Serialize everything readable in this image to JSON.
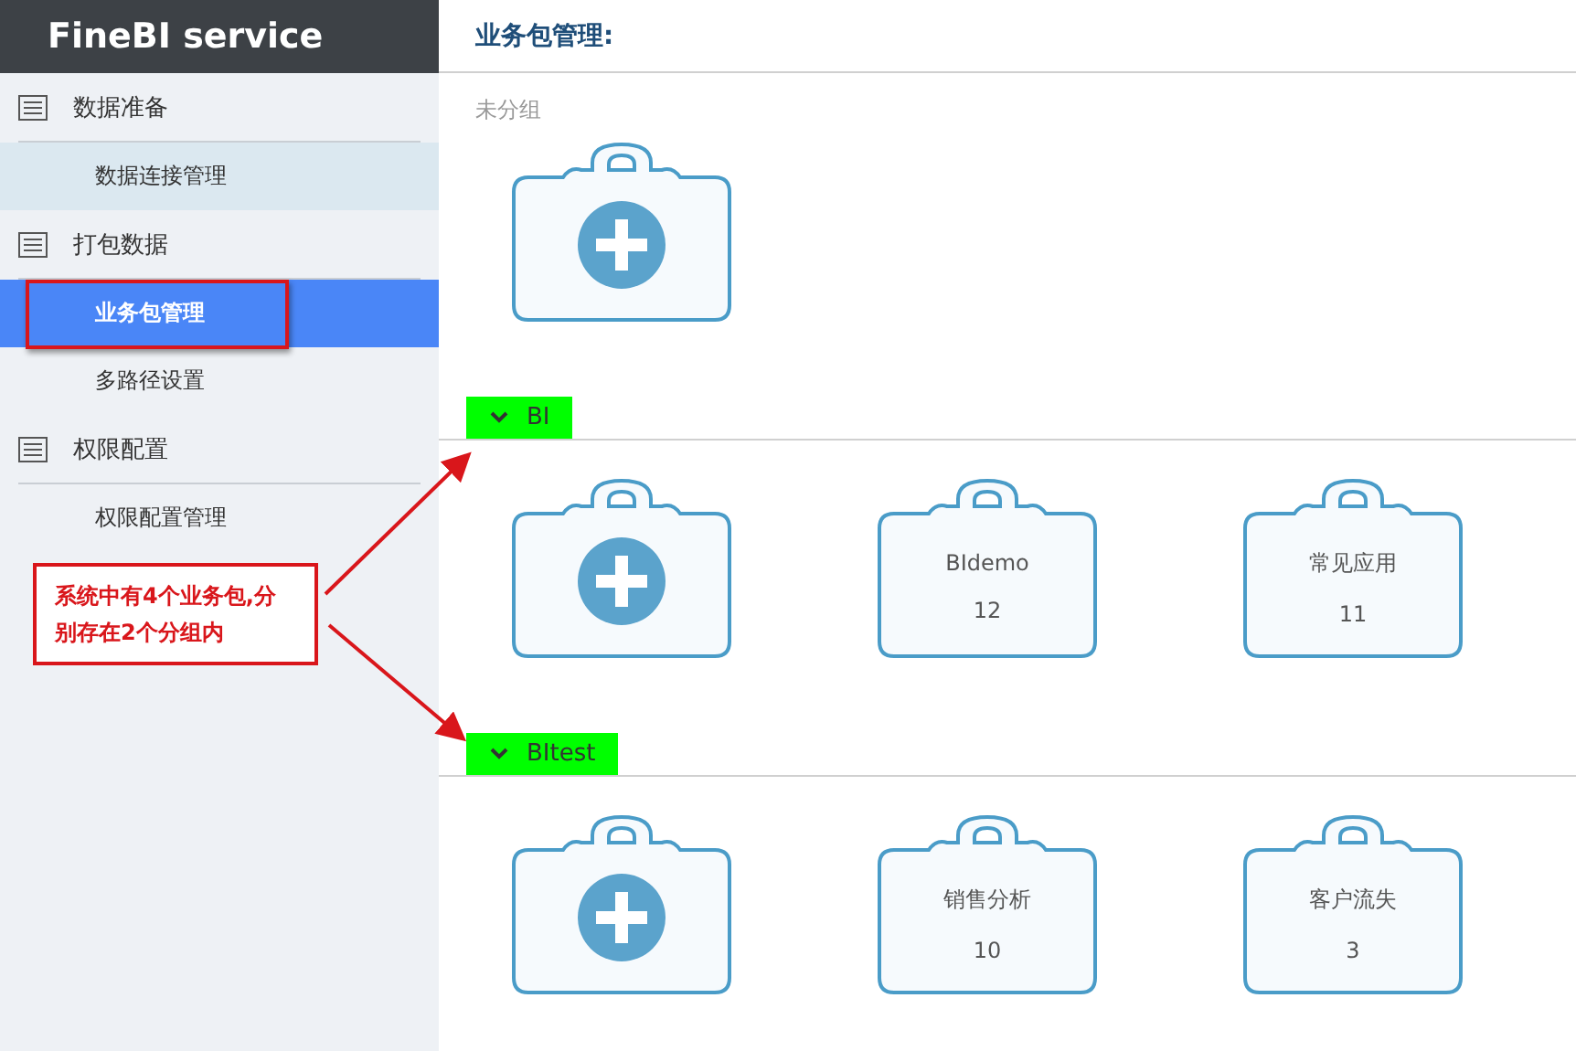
{
  "brand": "FineBI service",
  "sidebar": {
    "sections": [
      {
        "label": "数据准备",
        "items": [
          {
            "label": "数据连接管理",
            "selected": false,
            "hovered": true
          }
        ]
      },
      {
        "label": "打包数据",
        "items": [
          {
            "label": "业务包管理",
            "selected": true,
            "hovered": false
          },
          {
            "label": "多路径设置",
            "selected": false,
            "hovered": false
          }
        ]
      },
      {
        "label": "权限配置",
        "items": [
          {
            "label": "权限配置管理",
            "selected": false,
            "hovered": false
          }
        ]
      }
    ]
  },
  "page_title": "业务包管理:",
  "groups": [
    {
      "kind": "plain",
      "label": "未分组"
    },
    {
      "kind": "collapsible",
      "label": "BI",
      "expanded": true,
      "packages": [
        {
          "name": "BIdemo",
          "count": "12"
        },
        {
          "name": "常见应用",
          "count": "11"
        }
      ]
    },
    {
      "kind": "collapsible",
      "label": "BItest",
      "expanded": true,
      "packages": [
        {
          "name": "销售分析",
          "count": "10"
        },
        {
          "name": "客户流失",
          "count": "3"
        }
      ]
    }
  ],
  "callout": {
    "text": "系统中有4个业务包,分别存在2个分组内"
  }
}
